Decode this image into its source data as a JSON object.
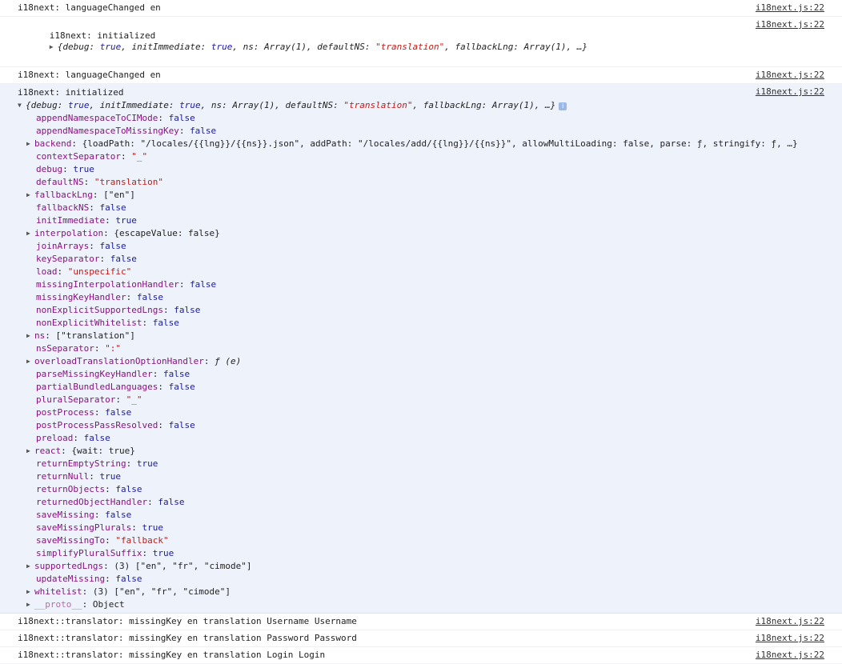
{
  "messages": [
    {
      "text": "i18next: languageChanged en",
      "source": "i18next.js:22"
    },
    {
      "text": "i18next: initialized",
      "source": "i18next.js:22",
      "preview": [
        "{debug: ",
        "true",
        ", initImmediate: ",
        "true",
        ", ns: Array(1), defaultNS: ",
        "\"translation\"",
        ", fallbackLng: Array(1), …}"
      ]
    },
    {
      "text": "i18next: languageChanged en",
      "source": "i18next.js:22"
    }
  ],
  "expanded": {
    "head": "i18next: initialized",
    "source": "i18next.js:22",
    "summary": [
      "{debug: ",
      "true",
      ", initImmediate: ",
      "true",
      ", ns: Array(1), defaultNS: ",
      "\"translation\"",
      ", fallbackLng: Array(1), …}"
    ],
    "info_icon": "i",
    "props": [
      {
        "k": "appendNamespaceToCIMode",
        "v": "false",
        "t": "bool"
      },
      {
        "k": "appendNamespaceToMissingKey",
        "v": "false",
        "t": "bool"
      },
      {
        "k": "backend",
        "v": "{loadPath: \"/locales/{{lng}}/{{ns}}.json\", addPath: \"/locales/add/{{lng}}/{{ns}}\", allowMultiLoading: false, parse: ƒ, stringify: ƒ, …}",
        "t": "obj",
        "exp": true
      },
      {
        "k": "contextSeparator",
        "v": "\"_\"",
        "t": "str"
      },
      {
        "k": "debug",
        "v": "true",
        "t": "bool"
      },
      {
        "k": "defaultNS",
        "v": "\"translation\"",
        "t": "str"
      },
      {
        "k": "fallbackLng",
        "v": "[\"en\"]",
        "t": "obj",
        "exp": true
      },
      {
        "k": "fallbackNS",
        "v": "false",
        "t": "bool"
      },
      {
        "k": "initImmediate",
        "v": "true",
        "t": "bool"
      },
      {
        "k": "interpolation",
        "v": "{escapeValue: false}",
        "t": "obj",
        "exp": true
      },
      {
        "k": "joinArrays",
        "v": "false",
        "t": "bool"
      },
      {
        "k": "keySeparator",
        "v": "false",
        "t": "bool"
      },
      {
        "k": "load",
        "v": "\"unspecific\"",
        "t": "str"
      },
      {
        "k": "missingInterpolationHandler",
        "v": "false",
        "t": "bool"
      },
      {
        "k": "missingKeyHandler",
        "v": "false",
        "t": "bool"
      },
      {
        "k": "nonExplicitSupportedLngs",
        "v": "false",
        "t": "bool"
      },
      {
        "k": "nonExplicitWhitelist",
        "v": "false",
        "t": "bool"
      },
      {
        "k": "ns",
        "v": "[\"translation\"]",
        "t": "obj",
        "exp": true
      },
      {
        "k": "nsSeparator",
        "v": "\":\"",
        "t": "str"
      },
      {
        "k": "overloadTranslationOptionHandler",
        "v": "ƒ (e)",
        "t": "fn",
        "exp": true
      },
      {
        "k": "parseMissingKeyHandler",
        "v": "false",
        "t": "bool"
      },
      {
        "k": "partialBundledLanguages",
        "v": "false",
        "t": "bool"
      },
      {
        "k": "pluralSeparator",
        "v": "\"_\"",
        "t": "str"
      },
      {
        "k": "postProcess",
        "v": "false",
        "t": "bool"
      },
      {
        "k": "postProcessPassResolved",
        "v": "false",
        "t": "bool"
      },
      {
        "k": "preload",
        "v": "false",
        "t": "bool"
      },
      {
        "k": "react",
        "v": "{wait: true}",
        "t": "obj",
        "exp": true
      },
      {
        "k": "returnEmptyString",
        "v": "true",
        "t": "bool"
      },
      {
        "k": "returnNull",
        "v": "true",
        "t": "bool"
      },
      {
        "k": "returnObjects",
        "v": "false",
        "t": "bool"
      },
      {
        "k": "returnedObjectHandler",
        "v": "false",
        "t": "bool"
      },
      {
        "k": "saveMissing",
        "v": "false",
        "t": "bool"
      },
      {
        "k": "saveMissingPlurals",
        "v": "true",
        "t": "bool"
      },
      {
        "k": "saveMissingTo",
        "v": "\"fallback\"",
        "t": "str"
      },
      {
        "k": "simplifyPluralSuffix",
        "v": "true",
        "t": "bool"
      },
      {
        "k": "supportedLngs",
        "v": "(3) [\"en\", \"fr\", \"cimode\"]",
        "t": "obj",
        "exp": true
      },
      {
        "k": "updateMissing",
        "v": "false",
        "t": "bool"
      },
      {
        "k": "whitelist",
        "v": "(3) [\"en\", \"fr\", \"cimode\"]",
        "t": "obj",
        "exp": true
      },
      {
        "k": "__proto__",
        "v": "Object",
        "t": "proto",
        "exp": true
      }
    ]
  },
  "after": [
    {
      "text": "i18next::translator: missingKey en translation Username Username",
      "source": "i18next.js:22"
    },
    {
      "text": "i18next::translator: missingKey en translation Password Password",
      "source": "i18next.js:22"
    },
    {
      "text": "i18next::translator: missingKey en translation Login Login",
      "source": "i18next.js:22"
    }
  ]
}
